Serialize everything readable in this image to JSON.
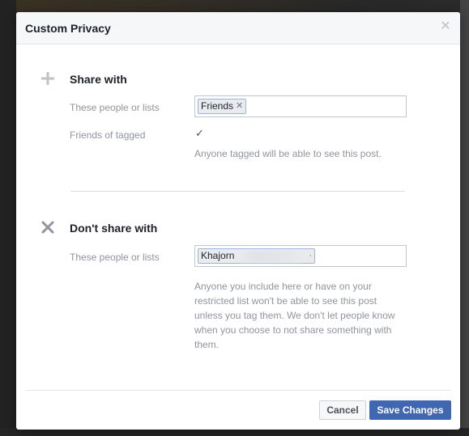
{
  "dialog": {
    "title": "Custom Privacy",
    "close_icon": "close-icon"
  },
  "share_with": {
    "icon": "plus-icon",
    "title": "Share with",
    "people_label": "These people or lists",
    "tokens": [
      "Friends"
    ],
    "friends_of_tagged_label": "Friends of tagged",
    "friends_of_tagged_checked": true,
    "help_text": "Anyone tagged will be able to see this post."
  },
  "dont_share_with": {
    "icon": "x-icon",
    "title": "Don't share with",
    "people_label": "These people or lists",
    "tokens": [
      "Khajorn"
    ],
    "help_lines": [
      "Anyone you include here or have on your",
      "restricted list won't be able to see this post",
      "unless you tag them. We don't let people know",
      "when you choose to not share something with",
      "them."
    ]
  },
  "footer": {
    "cancel_label": "Cancel",
    "save_label": "Save Changes"
  },
  "colors": {
    "primary_button": "#4267b2",
    "header_bg": "#f6f7f9",
    "muted_text": "#90949c"
  }
}
